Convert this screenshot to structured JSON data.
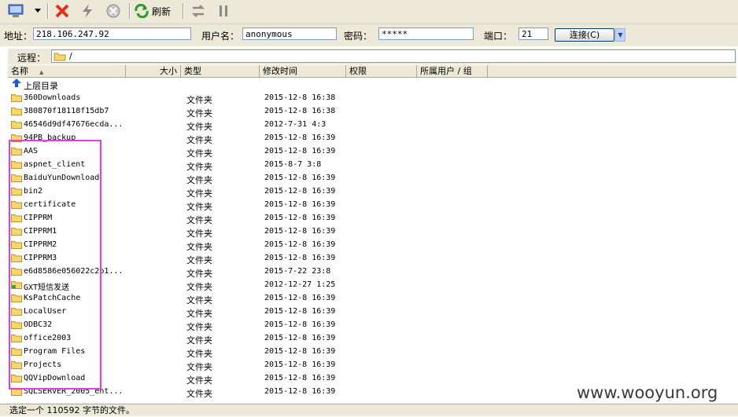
{
  "toolbar": {
    "icons": [
      "computer-icon",
      "dropdown-arrow-icon",
      "delete-icon",
      "flash-icon",
      "stop-icon",
      "refresh-icon",
      "transfer-icon",
      "pause-icon"
    ],
    "refresh_label": "刷新"
  },
  "address": {
    "addr_label": "地址：",
    "addr_value": "218.106.247.92",
    "user_label": "用户名：",
    "user_value": "anonymous",
    "pwd_label": "密码：",
    "pwd_value": "*****",
    "port_label": "端口：",
    "port_value": "21",
    "connect_label": "连接(C)"
  },
  "remote": {
    "label": "远程：",
    "path": "/"
  },
  "columns": {
    "name": "名称",
    "size": "大小",
    "type": "类型",
    "modified": "修改时间",
    "perm": "权限",
    "owner": "所属用户 / 组"
  },
  "parent_dir": "上层目录",
  "files": [
    {
      "name": "360Downloads",
      "type": "文件夹",
      "time": "2015-12-8 16:38"
    },
    {
      "name": "380870f18118f15db7",
      "type": "文件夹",
      "time": "2015-12-8 16:38"
    },
    {
      "name": "46546d9df47676ecda...",
      "type": "文件夹",
      "time": "2012-7-31 4:3"
    },
    {
      "name": "94PB_backup",
      "type": "文件夹",
      "time": "2015-12-8 16:39"
    },
    {
      "name": "AAS",
      "type": "文件夹",
      "time": "2015-12-8 16:39"
    },
    {
      "name": "aspnet_client",
      "type": "文件夹",
      "time": "2015-8-7 3:8"
    },
    {
      "name": "BaiduYunDownload",
      "type": "文件夹",
      "time": "2015-12-8 16:39"
    },
    {
      "name": "bin2",
      "type": "文件夹",
      "time": "2015-12-8 16:39"
    },
    {
      "name": "certificate",
      "type": "文件夹",
      "time": "2015-12-8 16:39"
    },
    {
      "name": "CIPPRM",
      "type": "文件夹",
      "time": "2015-12-8 16:39"
    },
    {
      "name": "CIPPRM1",
      "type": "文件夹",
      "time": "2015-12-8 16:39"
    },
    {
      "name": "CIPPRM2",
      "type": "文件夹",
      "time": "2015-12-8 16:39"
    },
    {
      "name": "CIPPRM3",
      "type": "文件夹",
      "time": "2015-12-8 16:39"
    },
    {
      "name": "e6d8586e056022c2b1...",
      "type": "文件夹",
      "time": "2015-7-22 23:8"
    },
    {
      "name": "GXT短信发送",
      "type": "文件夹",
      "time": "2012-12-27 1:25"
    },
    {
      "name": "KsPatchCache",
      "type": "文件夹",
      "time": "2015-12-8 16:39"
    },
    {
      "name": "LocalUser",
      "type": "文件夹",
      "time": "2015-12-8 16:39"
    },
    {
      "name": "ODBC32",
      "type": "文件夹",
      "time": "2015-12-8 16:39"
    },
    {
      "name": "office2003",
      "type": "文件夹",
      "time": "2015-12-8 16:39"
    },
    {
      "name": "Program Files",
      "type": "文件夹",
      "time": "2015-12-8 16:39"
    },
    {
      "name": "Projects",
      "type": "文件夹",
      "time": "2015-12-8 16:39"
    },
    {
      "name": "QQVipDownload",
      "type": "文件夹",
      "time": "2015-12-8 16:39"
    },
    {
      "name": "SQLSERVER_2005_ent...",
      "type": "文件夹",
      "time": "2015-12-8 16:39"
    }
  ],
  "status": "选定一个 110592 字节的文件。",
  "watermark": "www.wooyun.org",
  "colors": {
    "highlight": "#e43ed8",
    "folder": "#f5d76e",
    "chrome": "#ece9d8"
  }
}
